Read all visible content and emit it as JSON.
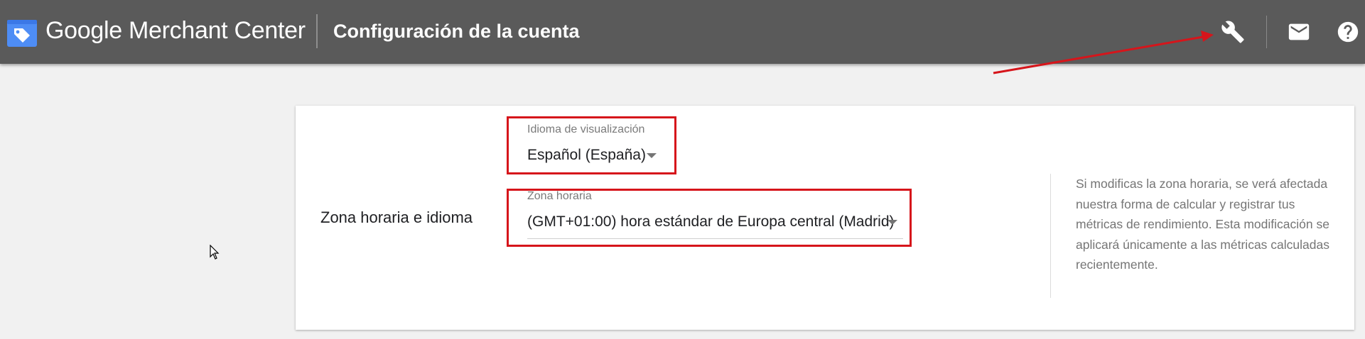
{
  "header": {
    "brand_google": "Google",
    "brand_product": "Merchant Center",
    "page_title": "Configuración de la cuenta",
    "background_color": "#5a5a5a",
    "icons": [
      "tag-icon",
      "wrench-icon",
      "mail-icon",
      "help-icon"
    ]
  },
  "settings": {
    "section_label": "Zona horaria e idioma",
    "language": {
      "label": "Idioma de visualización",
      "value": "Español (España)"
    },
    "timezone": {
      "label": "Zona horaria",
      "value": "(GMT+01:00) hora estándar de Europa central (Madrid)"
    },
    "help_text": "Si modificas la zona horaria, se verá afectada nuestra forma de calcular y registrar tus métricas de rendimiento. Esta modificación se aplicará únicamente a las métricas calculadas recientemente."
  },
  "annotations": {
    "highlight_color": "#d6151b"
  }
}
